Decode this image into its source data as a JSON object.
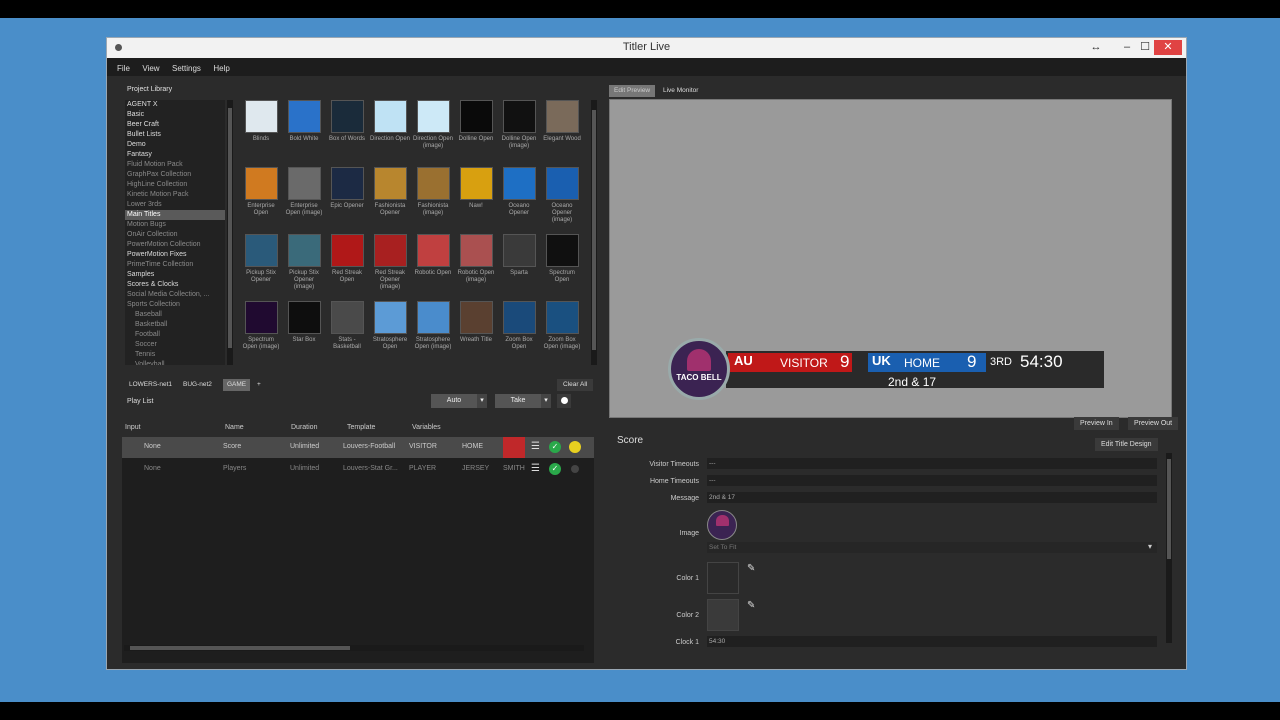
{
  "window": {
    "title": "Titler Live",
    "resize_glyph": "↔",
    "min_glyph": "–",
    "max_glyph": "☐",
    "close_glyph": "✕"
  },
  "menu": [
    "File",
    "View",
    "Settings",
    "Help"
  ],
  "library": {
    "title": "Project Library",
    "items": [
      {
        "label": "AGENT X",
        "dim": false
      },
      {
        "label": "Basic",
        "dim": false
      },
      {
        "label": "Beer Craft",
        "dim": false
      },
      {
        "label": "Bullet Lists",
        "dim": false
      },
      {
        "label": "Demo",
        "dim": false
      },
      {
        "label": "Fantasy",
        "dim": false
      },
      {
        "label": "Fluid Motion Pack",
        "dim": true
      },
      {
        "label": "GraphPax Collection",
        "dim": true
      },
      {
        "label": "HighLine Collection",
        "dim": true
      },
      {
        "label": "Kinetic Motion Pack",
        "dim": true
      },
      {
        "label": "Lower 3rds",
        "dim": true
      },
      {
        "label": "Main Titles",
        "dim": false,
        "selected": true
      },
      {
        "label": "Motion Bugs",
        "dim": true
      },
      {
        "label": "OnAir Collection",
        "dim": true
      },
      {
        "label": "PowerMotion Collection",
        "dim": true
      },
      {
        "label": "PowerMotion Fixes",
        "dim": false
      },
      {
        "label": "PrimeTime Collection",
        "dim": true
      },
      {
        "label": "Samples",
        "dim": false
      },
      {
        "label": "Scores & Clocks",
        "dim": false
      },
      {
        "label": "Social Media Collection, ...",
        "dim": true
      },
      {
        "label": "Sports Collection",
        "dim": true
      },
      {
        "label": "Baseball",
        "sub": true
      },
      {
        "label": "Basketball",
        "sub": true
      },
      {
        "label": "Football",
        "sub": true
      },
      {
        "label": "Soccer",
        "sub": true
      },
      {
        "label": "Tennis",
        "sub": true
      },
      {
        "label": "Volleyball",
        "sub": true
      }
    ],
    "templates": [
      {
        "caption": "Blinds",
        "color": "#dfe8ee"
      },
      {
        "caption": "Bold White",
        "color": "#2a72c9"
      },
      {
        "caption": "Box of Words",
        "color": "#1a2b3a"
      },
      {
        "caption": "Direction Open",
        "color": "#bfe2f4"
      },
      {
        "caption": "Direction Open (image)",
        "color": "#cde9f7"
      },
      {
        "caption": "Dolline Open",
        "color": "#0a0a0a"
      },
      {
        "caption": "Dolline Open (image)",
        "color": "#111"
      },
      {
        "caption": "Elegant Wood",
        "color": "#7a6a5a"
      },
      {
        "caption": "Enterprise Open",
        "color": "#d07a20"
      },
      {
        "caption": "Enterprise Open (image)",
        "color": "#6a6a6a"
      },
      {
        "caption": "Epic Opener",
        "color": "#1c2a44"
      },
      {
        "caption": "Fashionista Opener",
        "color": "#b8862e"
      },
      {
        "caption": "Fashionista (image)",
        "color": "#9a7030"
      },
      {
        "caption": "Naw!",
        "color": "#d8a010"
      },
      {
        "caption": "Oceano Opener",
        "color": "#1e6fc4"
      },
      {
        "caption": "Oceano Opener (image)",
        "color": "#1a5fb0"
      },
      {
        "caption": "Pickup Stix Opener",
        "color": "#2a5a7a"
      },
      {
        "caption": "Pickup Stix Opener (image)",
        "color": "#3a6a7a"
      },
      {
        "caption": "Red Streak Open",
        "color": "#b01818"
      },
      {
        "caption": "Red Streak Opener (image)",
        "color": "#a82020"
      },
      {
        "caption": "Robotic Open",
        "color": "#c04040"
      },
      {
        "caption": "Robotic Open (image)",
        "color": "#aa5050"
      },
      {
        "caption": "Sparta",
        "color": "#3a3a3a"
      },
      {
        "caption": "Spectrum Open",
        "color": "#101010"
      },
      {
        "caption": "Spectrum Open (image)",
        "color": "#200a30"
      },
      {
        "caption": "Star Box",
        "color": "#0e0e0e"
      },
      {
        "caption": "Stats - Basketball",
        "color": "#4a4a4a"
      },
      {
        "caption": "Stratosphere Open",
        "color": "#5c9bd6"
      },
      {
        "caption": "Stratosphere Open (image)",
        "color": "#4a8ccc"
      },
      {
        "caption": "Wreath Title",
        "color": "#5a4030"
      },
      {
        "caption": "Zoom Box Open",
        "color": "#1a4a7a"
      },
      {
        "caption": "Zoom Box Open (image)",
        "color": "#1a5080"
      }
    ]
  },
  "tabs": {
    "lowers": "LOWERS-net1",
    "bug": "BUG-net2",
    "game": "GAME",
    "add": "+",
    "clear_all": "Clear All"
  },
  "playlist": {
    "title": "Play List",
    "auto": "Auto",
    "take": "Take",
    "headers": {
      "input": "Input",
      "name": "Name",
      "duration": "Duration",
      "template": "Template",
      "variables": "Variables"
    },
    "rows": [
      {
        "input": "None",
        "name": "Score",
        "duration": "Unlimited",
        "template": "Louvers-Football",
        "var1": "VISITOR",
        "var2": "HOME",
        "selected": true
      },
      {
        "input": "None",
        "name": "Players",
        "duration": "Unlimited",
        "template": "Louvers-Stat Gr...",
        "var1": "PLAYER",
        "var2": "JERSEY",
        "var3": "SMITH",
        "selected": false
      }
    ]
  },
  "preview": {
    "tab_edit": "Edit Preview",
    "tab_live": "Live Monitor",
    "scorebug": {
      "visitor_label": "VISITOR",
      "visitor_score": "9",
      "home_label": "HOME",
      "home_score": "9",
      "period": "3RD",
      "clock": "54:30",
      "message": "2nd & 17",
      "logo_text": "TACO BELL",
      "visitor_color": "#c01818",
      "home_color": "#1a5fb0"
    },
    "preview_in": "Preview In",
    "preview_out": "Preview Out",
    "edit_design": "Edit Title Design"
  },
  "score_panel": {
    "title": "Score",
    "fields": {
      "visitor_timeouts_label": "Visitor Timeouts",
      "visitor_timeouts_value": "---",
      "home_timeouts_label": "Home Timeouts",
      "home_timeouts_value": "---",
      "message_label": "Message",
      "message_value": "2nd & 17",
      "image_label": "Image",
      "image_fit": "Set To Fit",
      "color1_label": "Color 1",
      "color2_label": "Color 2",
      "clock1_label": "Clock 1",
      "clock1_value": "54:30"
    }
  }
}
